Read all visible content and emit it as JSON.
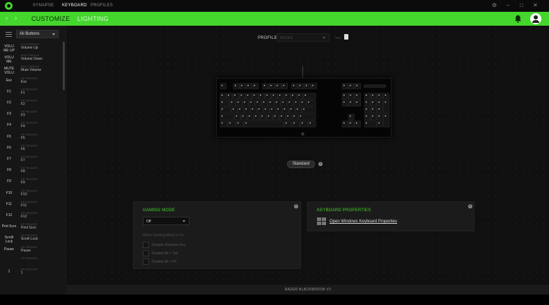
{
  "titlebar": {
    "tabs": [
      "SYNAPSE",
      "KEYBOARD",
      "PROFILES"
    ],
    "active_tab": "KEYBOARD",
    "controls": [
      "⚙",
      "–",
      "□",
      "✕"
    ]
  },
  "subnav": {
    "back": "‹",
    "forward": "›",
    "tabs": [
      "CUSTOMIZE",
      "LIGHTING"
    ],
    "active_tab": "CUSTOMIZE"
  },
  "sidebar": {
    "filter_label": "All Buttons",
    "items": [
      {
        "key": "VOLU ME UP",
        "category": "MULTIMEDIA",
        "function": "Volume Up"
      },
      {
        "key": "VOLU ME",
        "category": "MULTIMEDIA",
        "function": "Volume Down"
      },
      {
        "key": "MUTE VOLU",
        "category": "MULTIMEDIA",
        "function": "Mute Volume"
      },
      {
        "key": "Esc",
        "category": "KEYBOARD",
        "function": "Esc"
      },
      {
        "key": "F1",
        "category": "KEYBOARD",
        "function": "F1"
      },
      {
        "key": "F2",
        "category": "KEYBOARD",
        "function": "F2"
      },
      {
        "key": "F3",
        "category": "KEYBOARD",
        "function": "F3"
      },
      {
        "key": "F4",
        "category": "KEYBOARD",
        "function": "F4"
      },
      {
        "key": "F5",
        "category": "KEYBOARD",
        "function": "F5"
      },
      {
        "key": "F6",
        "category": "KEYBOARD",
        "function": "F6"
      },
      {
        "key": "F7",
        "category": "KEYBOARD",
        "function": "F7"
      },
      {
        "key": "F8",
        "category": "KEYBOARD",
        "function": "F8"
      },
      {
        "key": "F9",
        "category": "KEYBOARD",
        "function": "F9"
      },
      {
        "key": "F10",
        "category": "KEYBOARD",
        "function": "F10"
      },
      {
        "key": "F11",
        "category": "KEYBOARD",
        "function": "F11"
      },
      {
        "key": "F12",
        "category": "KEYBOARD",
        "function": "F12"
      },
      {
        "key": "Prnt Scrn",
        "category": "KEYBOARD",
        "function": "Print Scrn"
      },
      {
        "key": "Scroll Lock",
        "category": "KEYBOARD",
        "function": "Scroll Lock"
      },
      {
        "key": "Pause",
        "category": "KEYBOARD",
        "function": "Pause"
      },
      {
        "key": "",
        "category": "KEYBOARD",
        "function": ""
      },
      {
        "key": "1",
        "category": "KEYBOARD",
        "function": "1"
      }
    ]
  },
  "profile": {
    "label": "PROFILE",
    "value": "RAZER",
    "more": "···"
  },
  "keyboard_logo": "⟰",
  "mode_button": "Standard",
  "gaming_mode": {
    "title": "GAMING MODE",
    "value": "Off",
    "note": "When Gaming Mode is On:",
    "options": [
      "Disable Windows Key",
      "Disable Alt + Tab",
      "Disable Alt + F4"
    ]
  },
  "keyboard_properties": {
    "title": "KEYBOARD PROPERTIES",
    "link": "Open Windows Keyboard Properties"
  },
  "info_glyph": "i",
  "status": "RAZER BLACKWIDOW V3",
  "colors": {
    "accent": "#44d62c",
    "background": "#101010",
    "panel": "#1b1b1b"
  }
}
